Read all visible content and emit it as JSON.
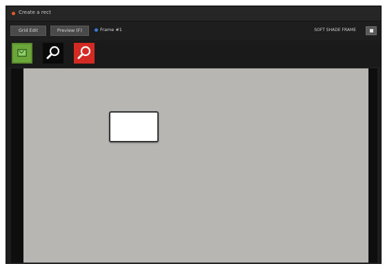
{
  "window": {
    "title": "Create a rect"
  },
  "toolbar": {
    "button_1": "Grid Edit",
    "button_2": "Preview (F)",
    "frame_label": "Frame #1",
    "right_label": "SOFT SHADE FRAME"
  },
  "tools": [
    {
      "name": "select-tool",
      "color": "#6aa63a",
      "icon": "select-rect-icon"
    },
    {
      "name": "zoom-in-tool",
      "color": "#0a0a0a",
      "icon": "magnifier-icon"
    },
    {
      "name": "zoom-out-tool",
      "color": "#d42a24",
      "icon": "magnifier-icon"
    }
  ],
  "canvas": {
    "background": "#b8b6b2"
  },
  "colors": {
    "accent": "#e25a2a",
    "frame_indicator": "#3a7bd5"
  }
}
